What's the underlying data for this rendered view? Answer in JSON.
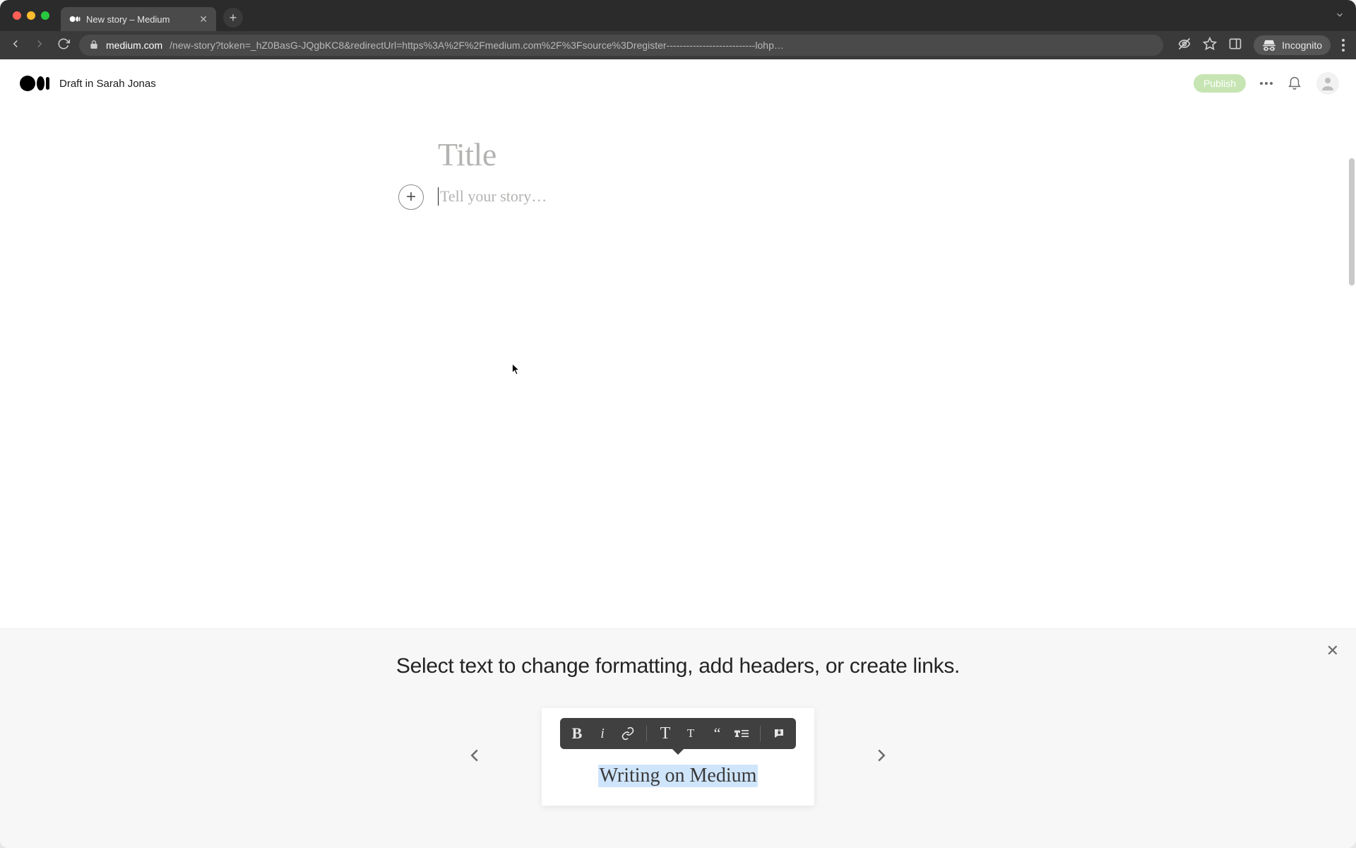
{
  "browser": {
    "tab_title": "New story – Medium",
    "url_domain": "medium.com",
    "url_path": "/new-story?token=_hZ0BasG-JQgbKC8&redirectUrl=https%3A%2F%2Fmedium.com%2F%3Fsource%3Dregister---------------------------lohp…",
    "incognito_label": "Incognito"
  },
  "header": {
    "draft_label": "Draft in Sarah Jonas",
    "publish_label": "Publish"
  },
  "editor": {
    "title_placeholder": "Title",
    "body_placeholder": "Tell your story…"
  },
  "tutorial": {
    "headline": "Select text to change formatting, add headers, or create links.",
    "example_text": "Writing on Medium",
    "toolbar": {
      "bold": "B",
      "italic": "i",
      "big_t": "T",
      "small_t": "T",
      "quote": "“"
    }
  }
}
